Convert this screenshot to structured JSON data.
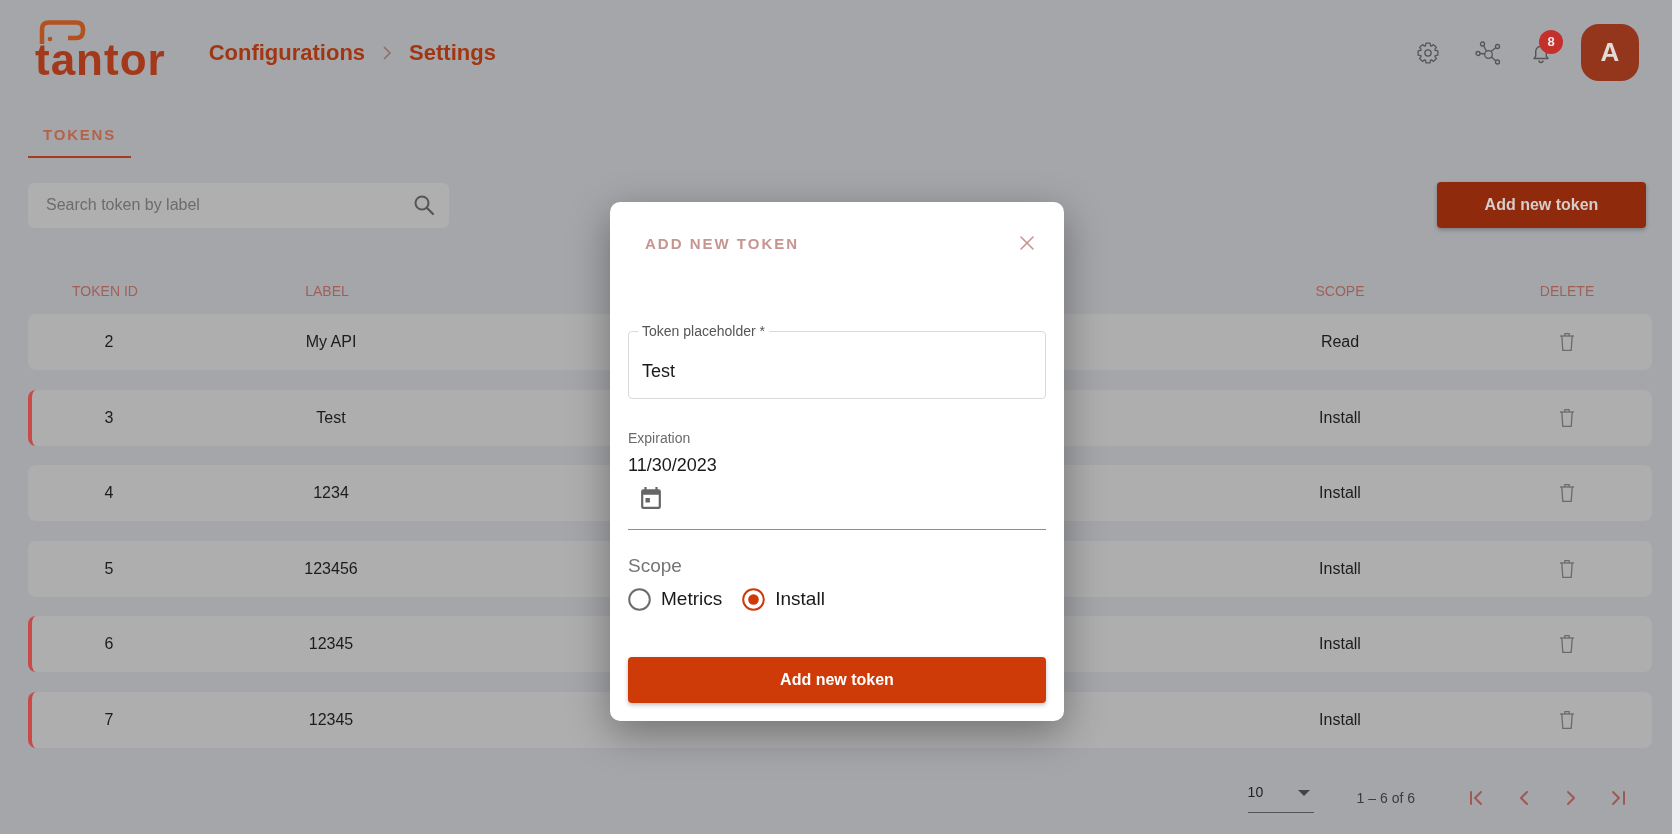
{
  "header": {
    "logo": "tantor",
    "breadcrumb": [
      "Configurations",
      "Settings"
    ],
    "notification_count": "8",
    "avatar": "A"
  },
  "tabs": [
    {
      "label": "TOKENS",
      "selected": true
    }
  ],
  "toolbar": {
    "search": {
      "placeholder": "Search token by label"
    },
    "add_button": "Add new token"
  },
  "table": {
    "columns": [
      "TOKEN ID",
      "LABEL",
      "SCOPE",
      "DELETE"
    ],
    "rows": [
      {
        "token_id": "2",
        "label": "My API",
        "scope": "Read",
        "flagged": false
      },
      {
        "token_id": "3",
        "label": "Test",
        "scope": "Install",
        "flagged": true
      },
      {
        "token_id": "4",
        "label": "1234",
        "scope": "Install",
        "flagged": false
      },
      {
        "token_id": "5",
        "label": "123456",
        "scope": "Install",
        "flagged": false
      },
      {
        "token_id": "6",
        "label": "12345",
        "scope": "Install",
        "flagged": true
      },
      {
        "token_id": "7",
        "label": "12345",
        "scope": "Install",
        "flagged": true
      }
    ]
  },
  "pagination": {
    "page_size": "10",
    "range": "1 – 6 of 6"
  },
  "dialog": {
    "title": "ADD NEW TOKEN",
    "token_field": {
      "label": "Token placeholder *",
      "value": "Test"
    },
    "expiration": {
      "label": "Expiration",
      "value": "11/30/2023"
    },
    "scope": {
      "label": "Scope",
      "options": [
        {
          "label": "Metrics",
          "selected": false
        },
        {
          "label": "Install",
          "selected": true
        }
      ]
    },
    "submit": "Add new token"
  }
}
